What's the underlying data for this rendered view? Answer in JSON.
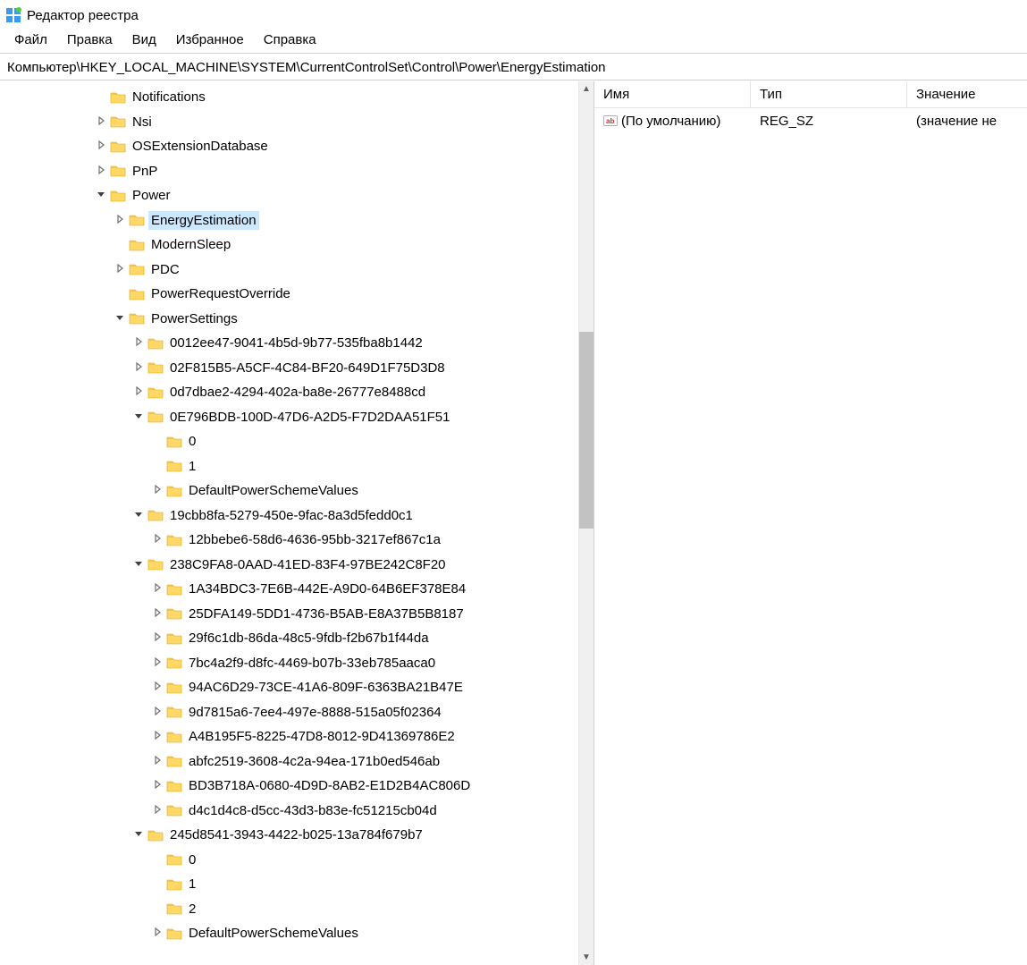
{
  "window": {
    "title": "Редактор реестра"
  },
  "menu": {
    "file": "Файл",
    "edit": "Правка",
    "view": "Вид",
    "favorites": "Избранное",
    "help": "Справка"
  },
  "address": "Компьютер\\HKEY_LOCAL_MACHINE\\SYSTEM\\CurrentControlSet\\Control\\Power\\EnergyEstimation",
  "columns": {
    "name": "Имя",
    "type": "Тип",
    "value": "Значение"
  },
  "values_list": [
    {
      "name": "(По умолчанию)",
      "type": "REG_SZ",
      "value": "(значение не"
    }
  ],
  "tree": [
    {
      "depth": 5,
      "exp": "blank",
      "label": "Notifications",
      "selected": false
    },
    {
      "depth": 5,
      "exp": "closed",
      "label": "Nsi",
      "selected": false
    },
    {
      "depth": 5,
      "exp": "closed",
      "label": "OSExtensionDatabase",
      "selected": false
    },
    {
      "depth": 5,
      "exp": "closed",
      "label": "PnP",
      "selected": false
    },
    {
      "depth": 5,
      "exp": "open",
      "label": "Power",
      "selected": false
    },
    {
      "depth": 6,
      "exp": "closed",
      "label": "EnergyEstimation",
      "selected": true
    },
    {
      "depth": 6,
      "exp": "blank",
      "label": "ModernSleep",
      "selected": false
    },
    {
      "depth": 6,
      "exp": "closed",
      "label": "PDC",
      "selected": false
    },
    {
      "depth": 6,
      "exp": "blank",
      "label": "PowerRequestOverride",
      "selected": false
    },
    {
      "depth": 6,
      "exp": "open",
      "label": "PowerSettings",
      "selected": false
    },
    {
      "depth": 7,
      "exp": "closed",
      "label": "0012ee47-9041-4b5d-9b77-535fba8b1442",
      "selected": false
    },
    {
      "depth": 7,
      "exp": "closed",
      "label": "02F815B5-A5CF-4C84-BF20-649D1F75D3D8",
      "selected": false
    },
    {
      "depth": 7,
      "exp": "closed",
      "label": "0d7dbae2-4294-402a-ba8e-26777e8488cd",
      "selected": false
    },
    {
      "depth": 7,
      "exp": "open",
      "label": "0E796BDB-100D-47D6-A2D5-F7D2DAA51F51",
      "selected": false
    },
    {
      "depth": 8,
      "exp": "blank",
      "label": "0",
      "selected": false
    },
    {
      "depth": 8,
      "exp": "blank",
      "label": "1",
      "selected": false
    },
    {
      "depth": 8,
      "exp": "closed",
      "label": "DefaultPowerSchemeValues",
      "selected": false
    },
    {
      "depth": 7,
      "exp": "open",
      "label": "19cbb8fa-5279-450e-9fac-8a3d5fedd0c1",
      "selected": false
    },
    {
      "depth": 8,
      "exp": "closed",
      "label": "12bbebe6-58d6-4636-95bb-3217ef867c1a",
      "selected": false
    },
    {
      "depth": 7,
      "exp": "open",
      "label": "238C9FA8-0AAD-41ED-83F4-97BE242C8F20",
      "selected": false
    },
    {
      "depth": 8,
      "exp": "closed",
      "label": "1A34BDC3-7E6B-442E-A9D0-64B6EF378E84",
      "selected": false
    },
    {
      "depth": 8,
      "exp": "closed",
      "label": "25DFA149-5DD1-4736-B5AB-E8A37B5B8187",
      "selected": false
    },
    {
      "depth": 8,
      "exp": "closed",
      "label": "29f6c1db-86da-48c5-9fdb-f2b67b1f44da",
      "selected": false
    },
    {
      "depth": 8,
      "exp": "closed",
      "label": "7bc4a2f9-d8fc-4469-b07b-33eb785aaca0",
      "selected": false
    },
    {
      "depth": 8,
      "exp": "closed",
      "label": "94AC6D29-73CE-41A6-809F-6363BA21B47E",
      "selected": false
    },
    {
      "depth": 8,
      "exp": "closed",
      "label": "9d7815a6-7ee4-497e-8888-515a05f02364",
      "selected": false
    },
    {
      "depth": 8,
      "exp": "closed",
      "label": "A4B195F5-8225-47D8-8012-9D41369786E2",
      "selected": false
    },
    {
      "depth": 8,
      "exp": "closed",
      "label": "abfc2519-3608-4c2a-94ea-171b0ed546ab",
      "selected": false
    },
    {
      "depth": 8,
      "exp": "closed",
      "label": "BD3B718A-0680-4D9D-8AB2-E1D2B4AC806D",
      "selected": false
    },
    {
      "depth": 8,
      "exp": "closed",
      "label": "d4c1d4c8-d5cc-43d3-b83e-fc51215cb04d",
      "selected": false
    },
    {
      "depth": 7,
      "exp": "open",
      "label": "245d8541-3943-4422-b025-13a784f679b7",
      "selected": false
    },
    {
      "depth": 8,
      "exp": "blank",
      "label": "0",
      "selected": false
    },
    {
      "depth": 8,
      "exp": "blank",
      "label": "1",
      "selected": false
    },
    {
      "depth": 8,
      "exp": "blank",
      "label": "2",
      "selected": false
    },
    {
      "depth": 8,
      "exp": "closed",
      "label": "DefaultPowerSchemeValues",
      "selected": false
    }
  ]
}
